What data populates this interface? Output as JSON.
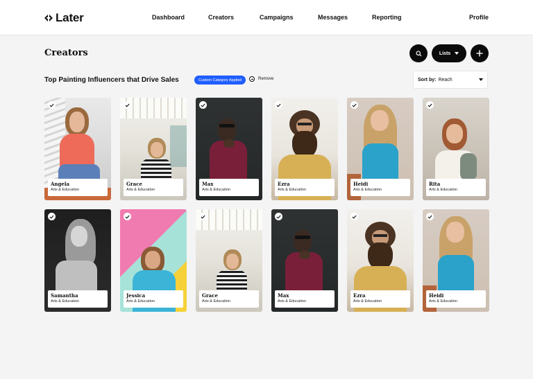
{
  "header": {
    "logo_text": "Later",
    "nav": [
      "Dashboard",
      "Creators",
      "Campaigns",
      "Messages",
      "Reporting"
    ],
    "profile": "Profile"
  },
  "page": {
    "title": "Creators",
    "lists_label": "Lists"
  },
  "list": {
    "title": "Top Painting Influencers that Drive Sales",
    "pill": "Custom Category Applied",
    "remove": "Remove",
    "sort_label": "Sort by:",
    "sort_value": "Reach"
  },
  "creators": [
    {
      "name": "Angela",
      "category": "Arts & Education"
    },
    {
      "name": "Grace",
      "category": "Arts & Education"
    },
    {
      "name": "Max",
      "category": "Arts & Education"
    },
    {
      "name": "Ezra",
      "category": "Arts & Education"
    },
    {
      "name": "Heidi",
      "category": "Arts & Education"
    },
    {
      "name": "Rita",
      "category": "Arts & Education"
    },
    {
      "name": "Samantha",
      "category": "Arts & Education"
    },
    {
      "name": "Jessica",
      "category": "Arts & Education"
    },
    {
      "name": "Grace",
      "category": "Arts & Education"
    },
    {
      "name": "Max",
      "category": "Arts & Education"
    },
    {
      "name": "Ezra",
      "category": "Arts & Education"
    },
    {
      "name": "Heidi",
      "category": "Arts & Education"
    }
  ],
  "colors": {
    "accent": "#1f5eff",
    "dark_button": "#0b0b0b",
    "background": "#f4f4f5"
  }
}
